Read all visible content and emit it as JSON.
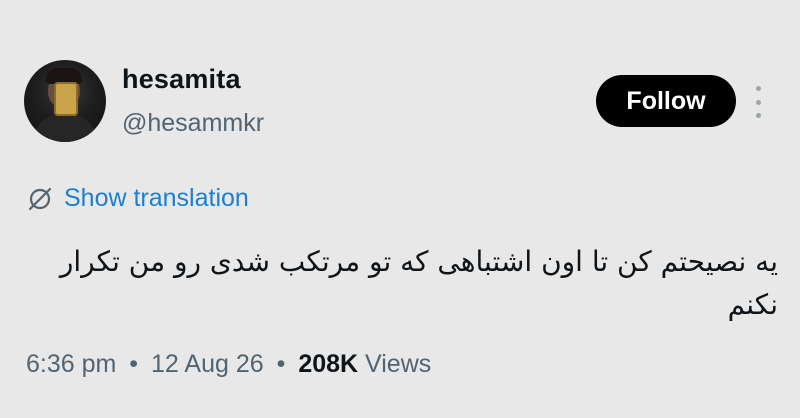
{
  "author": {
    "name": "hesamita",
    "handle": "@hesammkr"
  },
  "actions": {
    "follow_label": "Follow",
    "more_icon": "more-vertical-icon"
  },
  "translation": {
    "icon": "translate-off-icon",
    "label": "Show translation"
  },
  "tweet": {
    "text": "یه نصیحتم کن تا اون اشتباهی که تو مرتکب شدی رو من تکرار نکنم"
  },
  "meta": {
    "time": "6:36 pm",
    "date": "12 Aug 26",
    "separator": "•",
    "views_count": "208K",
    "views_label": "Views"
  },
  "colors": {
    "background": "#e8e8e8",
    "link": "#1d7fcf",
    "button": "#000000",
    "secondary_text": "#536471"
  }
}
